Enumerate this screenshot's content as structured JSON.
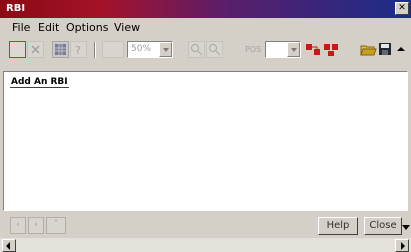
{
  "window": {
    "title": "RBI"
  },
  "menu": [
    "File",
    "Edit",
    "Options",
    "View"
  ],
  "toolbar": {
    "zoom_value": "50%",
    "pos_label": "POS",
    "icons": [
      "new-icon",
      "delete-icon",
      "grid-icon",
      "unknown-icon",
      "page-icon",
      "zoom-in-icon",
      "zoom-out-icon",
      "red-group-icon",
      "red-ungroup-icon",
      "open-folder-icon",
      "save-icon",
      "scroll-up-icon"
    ]
  },
  "content": {
    "link_label": "Add An RBI"
  },
  "bottom": {
    "help_label": "Help",
    "close_label": "Close"
  },
  "colors": {
    "title_start": "#8b0a14",
    "title_end": "#1a2d8a",
    "face": "#d4d0c8"
  }
}
